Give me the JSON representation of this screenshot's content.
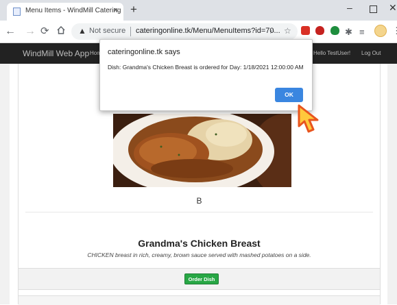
{
  "browser": {
    "tab_title": "Menu Items - WindMill Catering",
    "tab_close": "×",
    "new_tab": "+",
    "security_label": "Not secure",
    "url": "cateringonline.tk/Menu/MenuItems?id=70...",
    "window_min": "–",
    "window_close": "✕",
    "icons": [
      "back-arrow-icon",
      "forward-arrow-icon",
      "reload-icon",
      "home-icon",
      "warning-icon",
      "zoom-icon",
      "star-icon",
      "extension-icons",
      "profile-avatar",
      "more-icon"
    ]
  },
  "site_nav": {
    "brand": "WindMill Web App",
    "home_link": "Hom",
    "hello": "Hello TestUser!",
    "logout": "Log Out"
  },
  "dialog": {
    "title": "cateringonline.tk says",
    "message": "Dish: Grandma's Chicken Breast is ordered for Day: 1/18/2021 12:00:00 AM",
    "ok_label": "OK"
  },
  "dish": {
    "rating_letter": "B",
    "name": "Grandma's Chicken Breast",
    "description": "CHICKEN breast in rich, creamy, brown sauce served with mashed potatoes on a side.",
    "order_label": "Order Dish"
  },
  "colors": {
    "accent_blue": "#3a86e0",
    "order_green": "#28a745",
    "navbar": "#222222",
    "cursor": "#ffc93c"
  }
}
